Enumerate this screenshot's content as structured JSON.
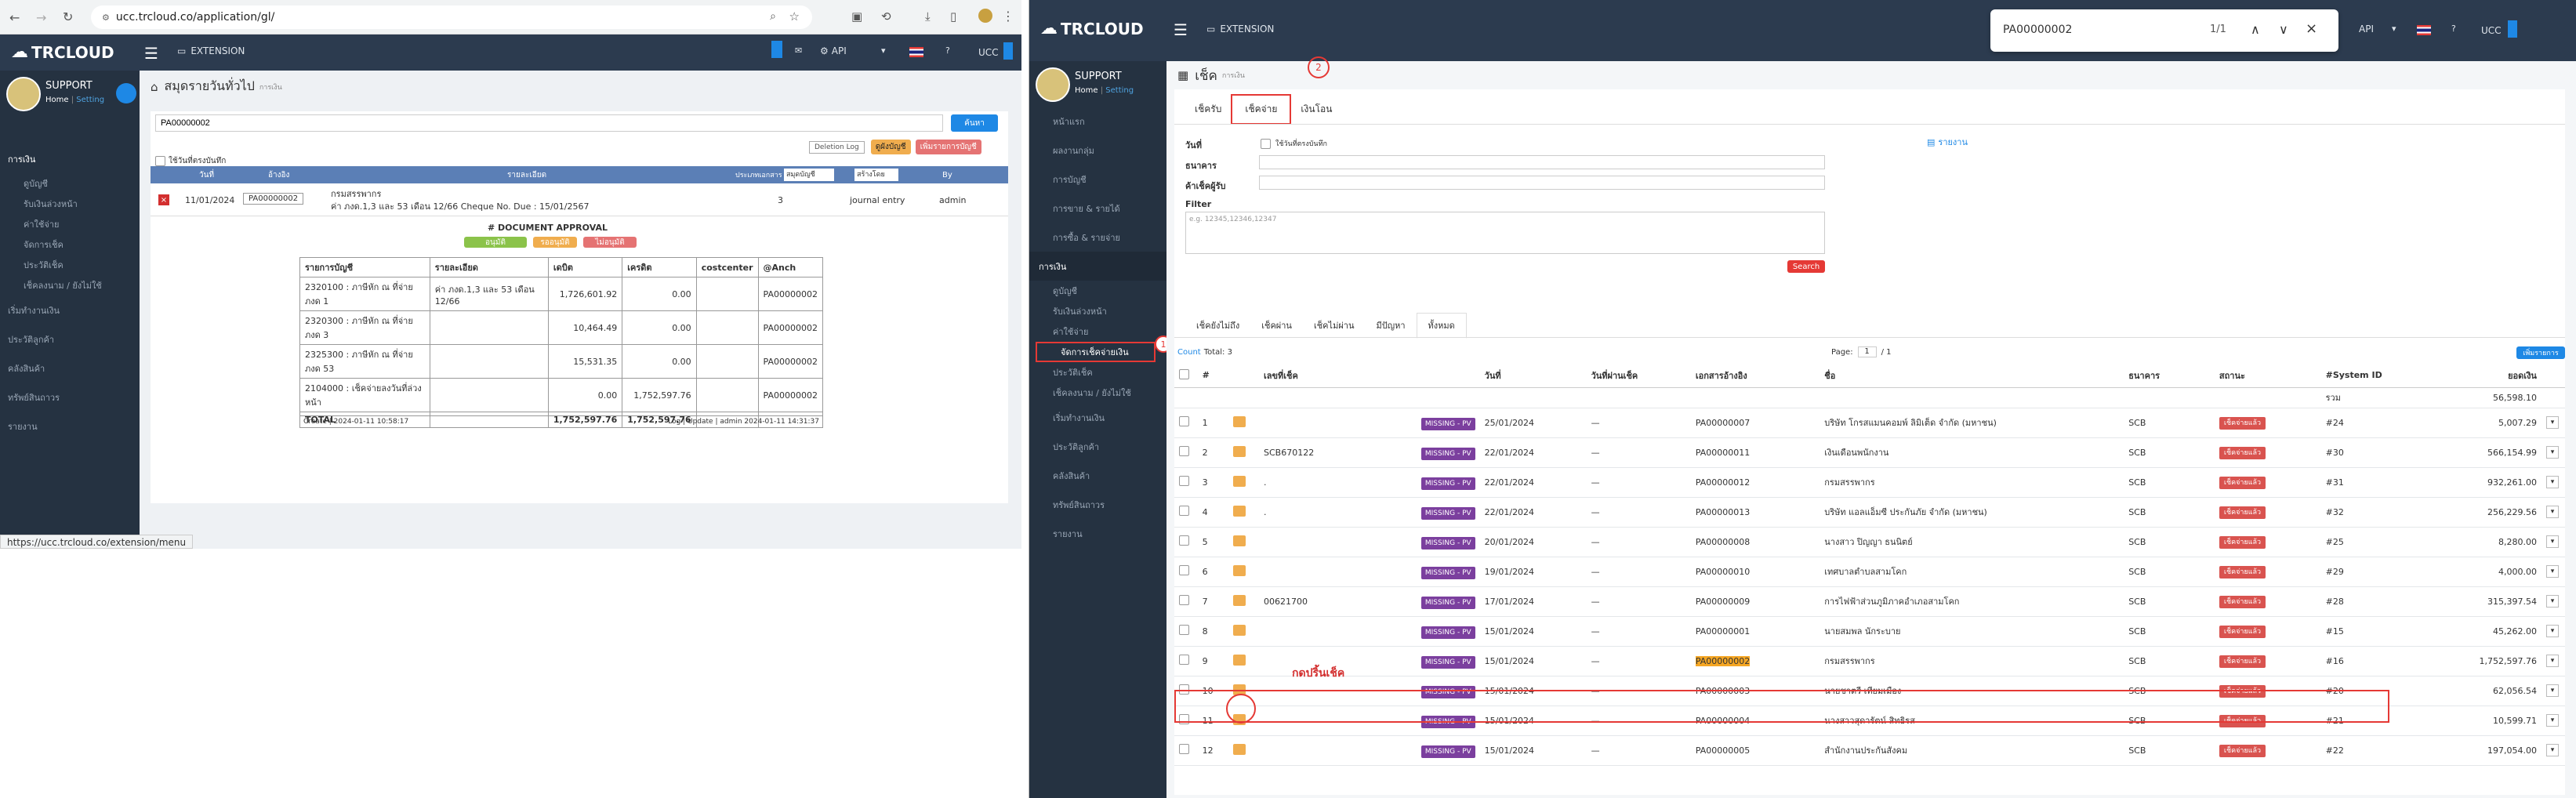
{
  "left": {
    "url": "ucc.trcloud.co/application/gl/",
    "brand": "TRCLOUD",
    "nav_extension": "EXTENSION",
    "nav_api": "API",
    "nav_company": "UCC",
    "user_name": "SUPPORT",
    "user_home": "Home",
    "user_setting": "Setting",
    "page_title": "สมุดรายวันทั่วไป",
    "page_subtitle": "การเงิน",
    "search_value": "PA00000002",
    "search_button": "ค้นหา",
    "deletion_log": "Deletion Log",
    "btn_yellow": "ดูผังบัญชี",
    "btn_red": "เพิ่มรายการบัญชี",
    "show_by_date": "ใช้วันที่ตรงบันทึก",
    "sidebar": [
      "การเงิน",
      "ดูบัญชี",
      "รับเงินล่วงหน้า",
      "ค่าใช้จ่าย",
      "จัดการเช็ค",
      "ประวัติเช็ค",
      "เช็คลงนาม / ยังไม่ใช้",
      "เริ่มทำงานเงิน",
      "ประวัติลูกค้า",
      "คลังสินค้า",
      "ทรัพย์สินถาวร",
      "รายงาน"
    ],
    "table_headers": {
      "date": "วันที่",
      "ref": "อ้างอิง",
      "detail": "รายละเอียด",
      "doctype": "ประเภทเอกสาร",
      "per": "สมุดบัญชี",
      "all": "สร้างโดย",
      "by": "By"
    },
    "entry": {
      "date": "11/01/2024",
      "ref": "PA00000002",
      "line1": "กรมสรรพากร",
      "line2": "ค่า ภงด.1,3 และ 53 เดือน 12/66 Cheque No. Due : 15/01/2567",
      "count": "3",
      "type": "journal entry",
      "by": "admin"
    },
    "doc_approval": "# DOCUMENT APPROVAL",
    "approve_green": "อนุมัติ",
    "approve_yellow": "รออนุมัติ",
    "approve_red": "ไม่อนุมัติ",
    "je_headers": [
      "รายการบัญชี",
      "รายละเอียด",
      "เดบิต",
      "เครดิต",
      "costcenter",
      "@Anch"
    ],
    "je_rows": [
      [
        "2320100 : ภาษีหัก ณ ที่จ่าย ภงด 1",
        "ค่า ภงด.1,3 และ 53 เดือน 12/66",
        "1,726,601.92",
        "0.00",
        "",
        "PA00000002"
      ],
      [
        "2320300 : ภาษีหัก ณ ที่จ่าย ภงด 3",
        "",
        "10,464.49",
        "0.00",
        "",
        "PA00000002"
      ],
      [
        "2325300 : ภาษีหัก ณ ที่จ่าย ภงด 53",
        "",
        "15,531.35",
        "0.00",
        "",
        "PA00000002"
      ],
      [
        "2104000 : เช็คจ่ายลงวันที่ล่วงหน้า",
        "",
        "0.00",
        "1,752,597.76",
        "",
        "PA00000002"
      ]
    ],
    "je_total": [
      "TOTAL",
      "",
      "1,752,597.76",
      "1,752,597.76",
      "",
      ""
    ],
    "created": "Create | 2024-01-11 10:58:17",
    "updated": "Log | Update | admin 2024-01-11 14:31:37",
    "status_url": "https://ucc.trcloud.co/extension/menu"
  },
  "right": {
    "brand": "TRCLOUD",
    "nav_extension": "EXTENSION",
    "nav_api": "API",
    "nav_company": "UCC",
    "find_value": "PA00000002",
    "find_count": "1/1",
    "user_name": "SUPPORT",
    "user_home": "Home",
    "user_setting": "Setting",
    "page_title": "เช็ค",
    "page_subtitle": "การเงิน",
    "tabs": [
      "เช็ครับ",
      "เช็คจ่าย",
      "เงินโอน"
    ],
    "annotation_1": "1",
    "annotation_2": "2",
    "annotation_text": "กดปริ้นเช็ค",
    "sidebar": [
      "หน้าแรก",
      "ผลงานกลุ่ม",
      "การบัญชี",
      "การขาย & รายได้",
      "การซื้อ & รายจ่าย",
      "การเงิน",
      "ดูบัญชี",
      "รับเงินล่วงหน้า",
      "ค่าใช้จ่าย",
      "จัดการเช็คจ่ายเงิน",
      "ประวัติเช็ค",
      "เช็คลงนาม / ยังไม่ใช้",
      "เริ่มทำงานเงิน",
      "ประวัติลูกค้า",
      "คลังสินค้า",
      "ทรัพย์สินถาวร",
      "รายงาน"
    ],
    "form": {
      "date": "วันที่",
      "show_by": "ใช้วันที่ตรงบันทึก",
      "bank": "ธนาคาร",
      "payee": "ค้าเช็คผู้รับ",
      "filter": "Filter",
      "filter_placeholder": "e.g. 12345,12346,12347",
      "search": "Search",
      "report": "รายงาน"
    },
    "status_tabs": [
      "เช็คยังไม่ถึง",
      "เช็คผ่าน",
      "เช็คไม่ผ่าน",
      "มีปัญหา",
      "ทั้งหมด"
    ],
    "count_label": "Count",
    "total_label": "Total: 3",
    "page_label": "Page:",
    "page_num": "1",
    "page_of": "/ 1",
    "add_button": "เพิ่มรายการ",
    "headers": [
      "#",
      "",
      "เลขที่เช็ค",
      "",
      "วันที่",
      "วันที่ผ่านเช็ค",
      "เอกสารอ้างอิง",
      "ชื่อ",
      "ธนาคาร",
      "สถานะ",
      "#System ID",
      "ยอดเงิน"
    ],
    "sum_label": "รวม",
    "sum_value": "56,598.10",
    "rows": [
      {
        "n": "1",
        "chq": "",
        "date": "25/01/2024",
        "pass": "—",
        "doc": "PA00000007",
        "name": "บริษัท โกรสแมนคอมพ์ ลิมิเต็ด จำกัด (มหาชน)",
        "bank": "SCB",
        "sys": "#24",
        "amt": "5,007.29"
      },
      {
        "n": "2",
        "chq": "SCB670122",
        "date": "22/01/2024",
        "pass": "—",
        "doc": "PA00000011",
        "name": "เงินเดือนพนักงาน",
        "bank": "SCB",
        "sys": "#30",
        "amt": "566,154.99"
      },
      {
        "n": "3",
        "chq": ".",
        "date": "22/01/2024",
        "pass": "—",
        "doc": "PA00000012",
        "name": "กรมสรรพากร",
        "bank": "SCB",
        "sys": "#31",
        "amt": "932,261.00"
      },
      {
        "n": "4",
        "chq": ".",
        "date": "22/01/2024",
        "pass": "—",
        "doc": "PA00000013",
        "name": "บริษัท แอลแอ็มซี ประกันภัย จำกัด (มหาชน)",
        "bank": "SCB",
        "sys": "#32",
        "amt": "256,229.56"
      },
      {
        "n": "5",
        "chq": "",
        "date": "20/01/2024",
        "pass": "—",
        "doc": "PA00000008",
        "name": "นางสาว ปิญญา ธนนิตย์",
        "bank": "SCB",
        "sys": "#25",
        "amt": "8,280.00"
      },
      {
        "n": "6",
        "chq": "",
        "date": "19/01/2024",
        "pass": "—",
        "doc": "PA00000010",
        "name": "เทศบาลตำบลสามโคก",
        "bank": "SCB",
        "sys": "#29",
        "amt": "4,000.00"
      },
      {
        "n": "7",
        "chq": "00621700",
        "date": "17/01/2024",
        "pass": "—",
        "doc": "PA00000009",
        "name": "การไฟฟ้าส่วนภูมิภาคอำเภอสามโคก",
        "bank": "SCB",
        "sys": "#28",
        "amt": "315,397.54"
      },
      {
        "n": "8",
        "chq": "",
        "date": "15/01/2024",
        "pass": "—",
        "doc": "PA00000001",
        "name": "นายสมพล นักระบาย",
        "bank": "SCB",
        "sys": "#15",
        "amt": "45,262.00"
      },
      {
        "n": "9",
        "chq": "",
        "date": "15/01/2024",
        "pass": "—",
        "doc": "PA00000002",
        "name": "กรมสรรพากร",
        "bank": "SCB",
        "sys": "#16",
        "amt": "1,752,597.76"
      },
      {
        "n": "10",
        "chq": "",
        "date": "15/01/2024",
        "pass": "—",
        "doc": "PA00000003",
        "name": "นายชาตรี เทียมเมือง",
        "bank": "SCB",
        "sys": "#20",
        "amt": "62,056.54"
      },
      {
        "n": "11",
        "chq": "",
        "date": "15/01/2024",
        "pass": "—",
        "doc": "PA00000004",
        "name": "นางสาวสุดารัตน์ สิทธิรส",
        "bank": "SCB",
        "sys": "#21",
        "amt": "10,599.71"
      },
      {
        "n": "12",
        "chq": "",
        "date": "15/01/2024",
        "pass": "—",
        "doc": "PA00000005",
        "name": "สำนักงานประกันสังคม",
        "bank": "SCB",
        "sys": "#22",
        "amt": "197,054.00"
      }
    ],
    "missing_label": "MISSING - PV",
    "status_label": "เช็คจ่ายแล้ว"
  },
  "colors": {
    "nav": "#2c3b4f",
    "sidebar": "#253241",
    "accent_blue": "#1e88e5",
    "highlight_red": "#e53935"
  }
}
